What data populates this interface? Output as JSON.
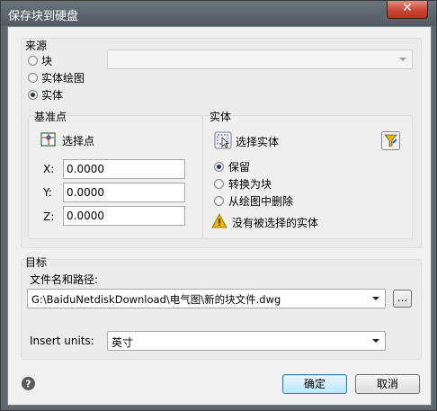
{
  "window": {
    "title": "保存块到硬盘",
    "close_glyph": "✕"
  },
  "source": {
    "title": "来源",
    "options": [
      {
        "label": "块",
        "checked": false
      },
      {
        "label": "实体绘图",
        "checked": false
      },
      {
        "label": "实体",
        "checked": true
      }
    ],
    "block_combo": {
      "value": "",
      "enabled": false
    }
  },
  "base_point": {
    "title": "基准点",
    "pick_label": "选择点",
    "x_label": "X:",
    "x_value": "0.0000",
    "y_label": "Y:",
    "y_value": "0.0000",
    "z_label": "Z:",
    "z_value": "0.0000"
  },
  "entities": {
    "title": "实体",
    "select_label": "选择实体",
    "options": [
      {
        "label": "保留",
        "checked": true
      },
      {
        "label": "转换为块",
        "checked": false
      },
      {
        "label": "从绘图中删除",
        "checked": false
      }
    ],
    "warning": "没有被选择的实体"
  },
  "target": {
    "title": "目标",
    "path_label": "文件名和路径:",
    "path_value": "G:\\BaiduNetdiskDownload\\电气图\\新的块文件.dwg",
    "browse_label": "...",
    "units_label": "Insert units:",
    "units_value": "英寸"
  },
  "buttons": {
    "ok": "确定",
    "cancel": "取消"
  },
  "colors": {
    "accent": "#3c7fb1",
    "title_bar": "#5e6670",
    "close": "#c74536",
    "warning": "#f0b400"
  },
  "icons": [
    "help-icon",
    "pick-point-icon",
    "select-entities-icon",
    "quick-select-filter-icon",
    "warning-icon",
    "close-icon"
  ]
}
